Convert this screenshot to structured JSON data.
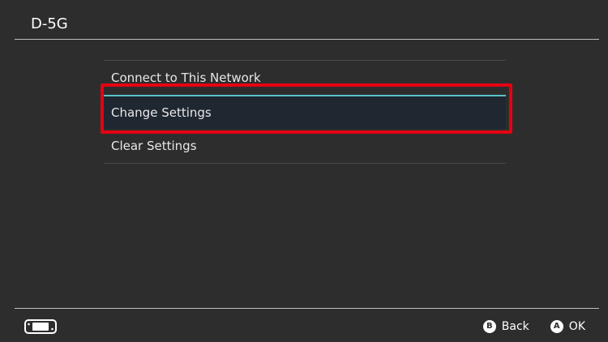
{
  "header": {
    "title": "D-5G"
  },
  "menu": {
    "items": [
      {
        "label": "Connect to This Network",
        "selected": false
      },
      {
        "label": "Change Settings",
        "selected": true
      },
      {
        "label": "Clear Settings",
        "selected": false
      }
    ]
  },
  "footer": {
    "console_icon": "switch-console-icon",
    "actions": [
      {
        "button": "B",
        "label": "Back"
      },
      {
        "button": "A",
        "label": "OK"
      }
    ]
  },
  "colors": {
    "background": "#2d2d2d",
    "selection_accent": "#58c3c9",
    "annotation_highlight": "#e60012"
  }
}
